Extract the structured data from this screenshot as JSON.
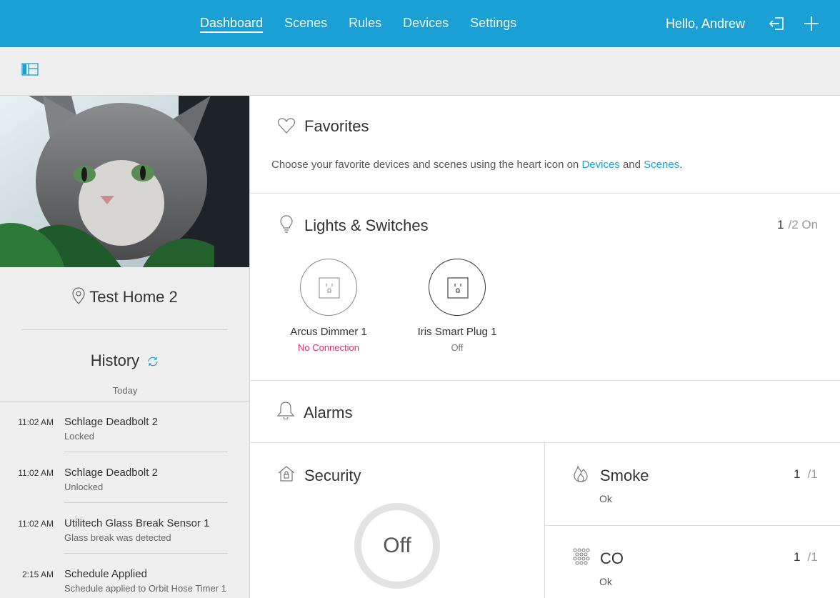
{
  "nav": {
    "items": [
      "Dashboard",
      "Scenes",
      "Rules",
      "Devices",
      "Settings"
    ],
    "active": "Dashboard",
    "greeting": "Hello, Andrew",
    "icons": [
      "logout-icon",
      "add-icon"
    ]
  },
  "colors": {
    "brand": "#1aa0d4",
    "error": "#d6336c",
    "text": "#333333"
  },
  "place": {
    "name": "Test Home 2"
  },
  "history": {
    "title": "History",
    "day": "Today",
    "items": [
      {
        "time": "11:02 AM",
        "title": "Schlage Deadbolt 2",
        "sub": "Locked"
      },
      {
        "time": "11:02 AM",
        "title": "Schlage Deadbolt 2",
        "sub": "Unlocked"
      },
      {
        "time": "11:02 AM",
        "title": "Utilitech Glass Break Sensor 1",
        "sub": "Glass break was detected"
      },
      {
        "time": "2:15 AM",
        "title": "Schedule Applied",
        "sub": "Schedule applied to Orbit Hose Timer 1"
      }
    ]
  },
  "favorites": {
    "title": "Favorites",
    "text_before": "Choose your favorite devices and scenes using the heart icon on ",
    "link_devices": "Devices",
    "text_and": " and ",
    "link_scenes": "Scenes",
    "text_end": "."
  },
  "lights": {
    "title": "Lights & Switches",
    "count_on": "1",
    "count_total": "/2 On",
    "devices": [
      {
        "name": "Arcus Dimmer 1",
        "status": "No Connection"
      },
      {
        "name": "Iris Smart Plug 1",
        "status": "Off"
      }
    ]
  },
  "alarms": {
    "title": "Alarms",
    "security": {
      "title": "Security",
      "state": "Off"
    },
    "smoke": {
      "title": "Smoke",
      "status": "Ok",
      "count": "1",
      "total": "/1"
    },
    "co": {
      "title": "CO",
      "status": "Ok",
      "count": "1",
      "total": "/1"
    }
  }
}
